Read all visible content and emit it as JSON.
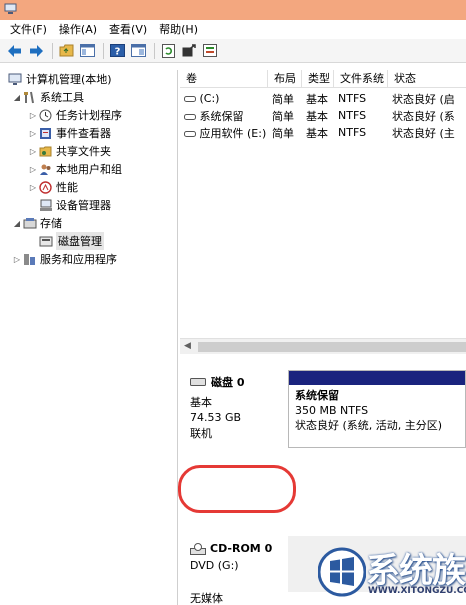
{
  "menu": [
    "文件(F)",
    "操作(A)",
    "查看(V)",
    "帮助(H)"
  ],
  "toolbar_icons": [
    "back-arrow-icon",
    "forward-arrow-icon",
    "folder-up-icon",
    "console-view-icon",
    "help-icon",
    "properties-icon",
    "refresh-icon",
    "export-icon",
    "options-icon"
  ],
  "tree": [
    {
      "label": "计算机管理(本地)",
      "icon": "computer-management-icon",
      "arrow": ""
    },
    {
      "label": "系统工具",
      "icon": "system-tools-icon",
      "arrow": "◢"
    },
    {
      "label": "任务计划程序",
      "icon": "task-scheduler-icon",
      "arrow": "▷"
    },
    {
      "label": "事件查看器",
      "icon": "event-viewer-icon",
      "arrow": "▷"
    },
    {
      "label": "共享文件夹",
      "icon": "shared-folders-icon",
      "arrow": "▷"
    },
    {
      "label": "本地用户和组",
      "icon": "local-users-icon",
      "arrow": "▷"
    },
    {
      "label": "性能",
      "icon": "performance-icon",
      "arrow": "▷"
    },
    {
      "label": "设备管理器",
      "icon": "device-manager-icon",
      "arrow": ""
    },
    {
      "label": "存储",
      "icon": "storage-icon",
      "arrow": "◢"
    },
    {
      "label": "磁盘管理",
      "icon": "disk-management-icon",
      "arrow": ""
    },
    {
      "label": "服务和应用程序",
      "icon": "services-apps-icon",
      "arrow": "▷"
    }
  ],
  "columns": [
    "卷",
    "布局",
    "类型",
    "文件系统",
    "状态"
  ],
  "volumes": [
    {
      "name": "(C:)",
      "layout": "简单",
      "type": "基本",
      "fs": "NTFS",
      "status": "状态良好 (启"
    },
    {
      "name": "系统保留",
      "layout": "简单",
      "type": "基本",
      "fs": "NTFS",
      "status": "状态良好 (系"
    },
    {
      "name": "应用软件 (E:)",
      "layout": "简单",
      "type": "基本",
      "fs": "NTFS",
      "status": "状态良好 (主"
    }
  ],
  "disk0": {
    "name": "磁盘 0",
    "kind": "基本",
    "size": "74.53 GB",
    "state": "联机"
  },
  "partition": {
    "name": "系统保留",
    "size": "350 MB NTFS",
    "status": "状态良好 (系统, 活动, 主分区)"
  },
  "cdrom": {
    "name": "CD-ROM 0",
    "drive": "DVD (G:)",
    "media": "无媒体"
  },
  "watermark": {
    "text": "系统族",
    "url": "WWW.XITONGZU.COM"
  },
  "colors": {
    "titlebar": "#f3a77f",
    "partition_bar": "#1a237e",
    "highlight_circle": "#e53935"
  }
}
